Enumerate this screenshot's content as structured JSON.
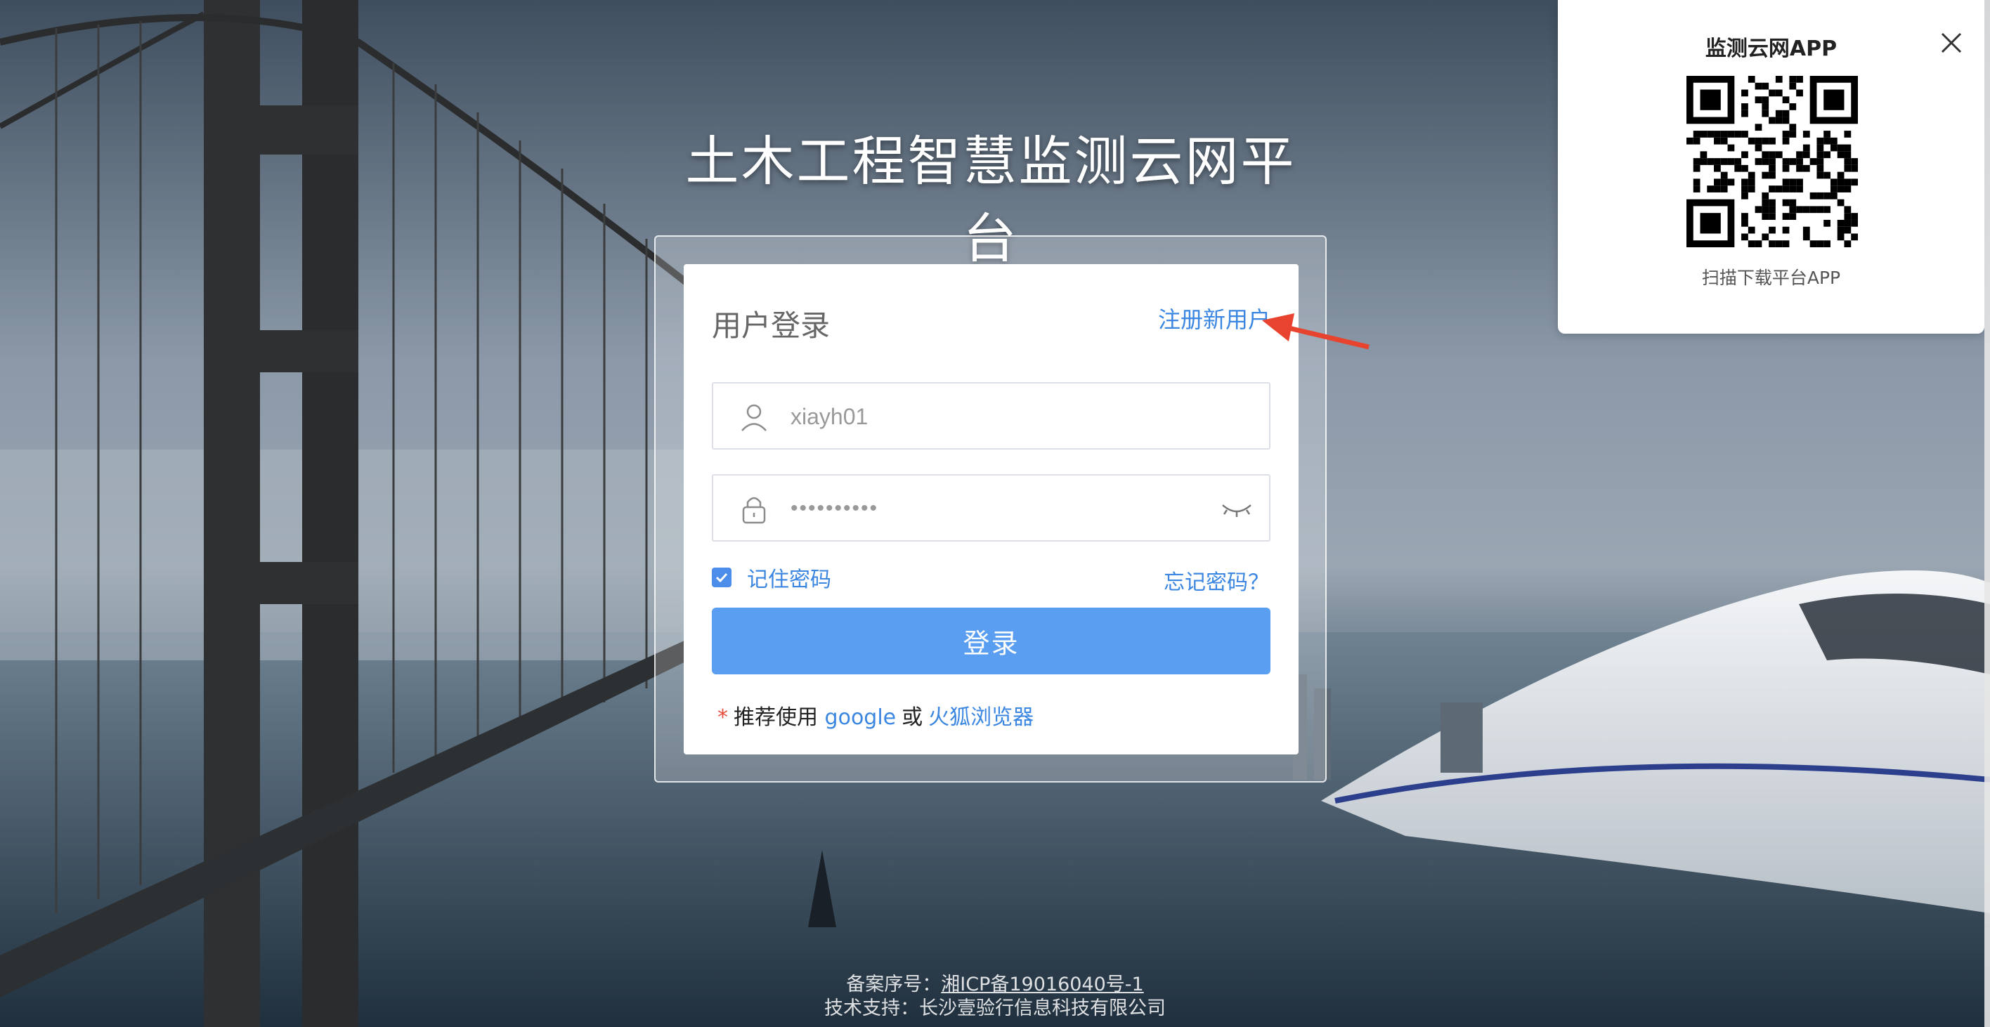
{
  "page": {
    "title": "土木工程智慧监测云网平台"
  },
  "login": {
    "heading": "用户登录",
    "register_link": "注册新用户",
    "username_value": "xiayh01",
    "password_value": "••••••••••",
    "remember_label": "记住密码",
    "remember_checked": true,
    "forgot_link": "忘记密码？",
    "submit_label": "登录",
    "tip_star": "*",
    "tip_prefix": "推荐使用",
    "tip_browser1": "google",
    "tip_or": "或",
    "tip_browser2": "火狐浏览器"
  },
  "qr_panel": {
    "title": "监测云网APP",
    "caption": "扫描下载平台APP"
  },
  "footer": {
    "icp_prefix": "备案序号：",
    "icp_number": "湘ICP备19016040号-1",
    "support": "技术支持：长沙壹验行信息科技有限公司"
  },
  "colors": {
    "accent": "#3b86e0",
    "button": "#5a9ef2",
    "annotation_arrow": "#e8432e"
  },
  "icons": {
    "user": "user-icon",
    "lock": "lock-icon",
    "eye": "eye-closed-icon",
    "close": "close-icon",
    "check": "check-icon"
  }
}
